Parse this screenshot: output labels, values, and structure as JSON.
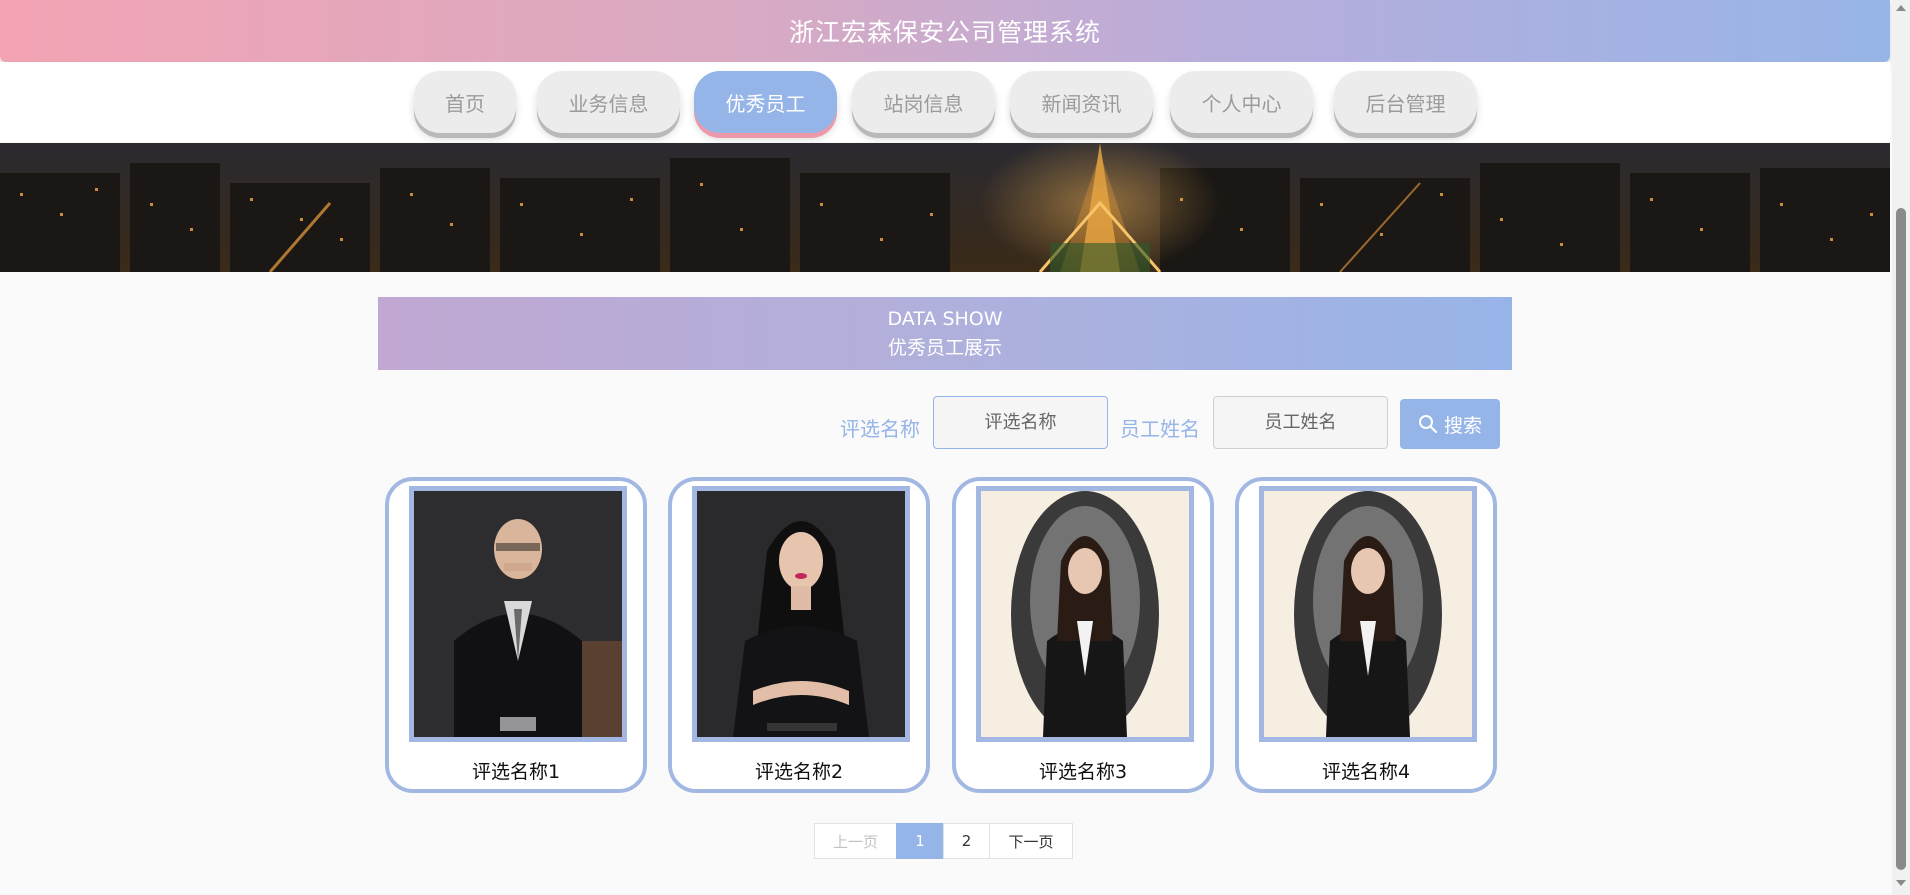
{
  "header": {
    "title": "浙江宏森保安公司管理系统"
  },
  "nav": {
    "items": [
      {
        "label": "首页",
        "active": false
      },
      {
        "label": "业务信息",
        "active": false
      },
      {
        "label": "优秀员工",
        "active": true
      },
      {
        "label": "站岗信息",
        "active": false
      },
      {
        "label": "新闻资讯",
        "active": false
      },
      {
        "label": "个人中心",
        "active": false
      },
      {
        "label": "后台管理",
        "active": false
      }
    ]
  },
  "section": {
    "title_en": "DATA SHOW",
    "title_cn": "优秀员工展示"
  },
  "search": {
    "field1_label": "评选名称",
    "field1_placeholder": "评选名称",
    "field2_label": "员工姓名",
    "field2_placeholder": "员工姓名",
    "button_label": "搜索",
    "button_icon": "search-icon"
  },
  "cards": [
    {
      "name": "评选名称1",
      "photo": "man in dark suit, dark background"
    },
    {
      "name": "评选名称2",
      "photo": "woman in black dress, arms crossed"
    },
    {
      "name": "评选名称3",
      "photo": "woman in black blazer, oval vignette"
    },
    {
      "name": "评选名称4",
      "photo": "woman in black blazer, oval vignette"
    }
  ],
  "pagination": {
    "prev": "上一页",
    "pages": [
      "1",
      "2"
    ],
    "current": "1",
    "next": "下一页"
  },
  "colors": {
    "accent": "#95b4e8",
    "pink": "#f2a3b3",
    "card_border": "#a2b7e2"
  }
}
